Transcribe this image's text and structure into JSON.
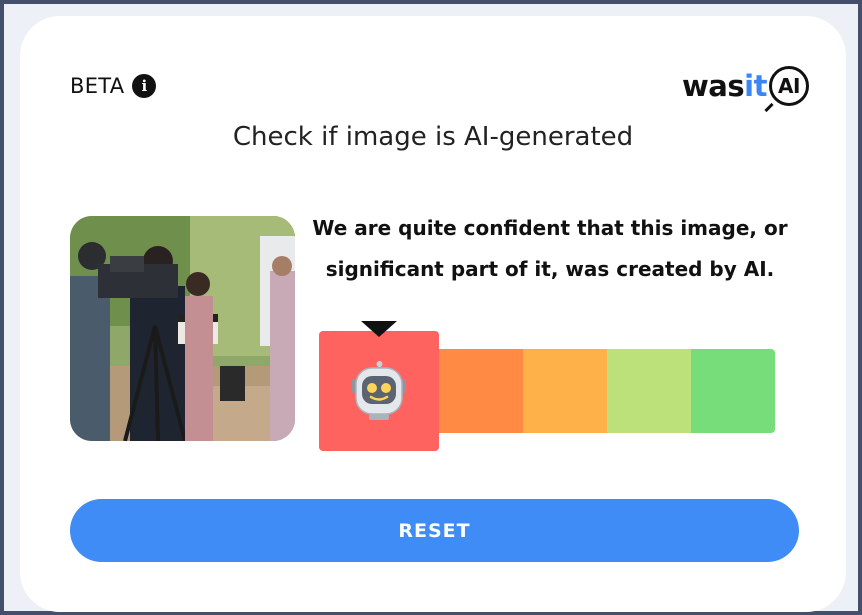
{
  "header": {
    "beta_label": "BETA",
    "info_icon": "info-icon",
    "logo": {
      "part1": "was",
      "part2": "it",
      "part3": "AI"
    }
  },
  "title": "Check if image is AI-generated",
  "result": {
    "verdict_line1": "We are quite confident that this image, or",
    "verdict_line2": "significant part of it, was created by AI.",
    "scale_colors": [
      "#fe6360",
      "#fe8a44",
      "#feb049",
      "#bde17a",
      "#76dd7a"
    ],
    "selected_level": 1,
    "selected_icon": "robot-icon"
  },
  "image": {
    "alt_subject": "film crew with camera and clapperboard"
  },
  "reset_label": "RESET"
}
